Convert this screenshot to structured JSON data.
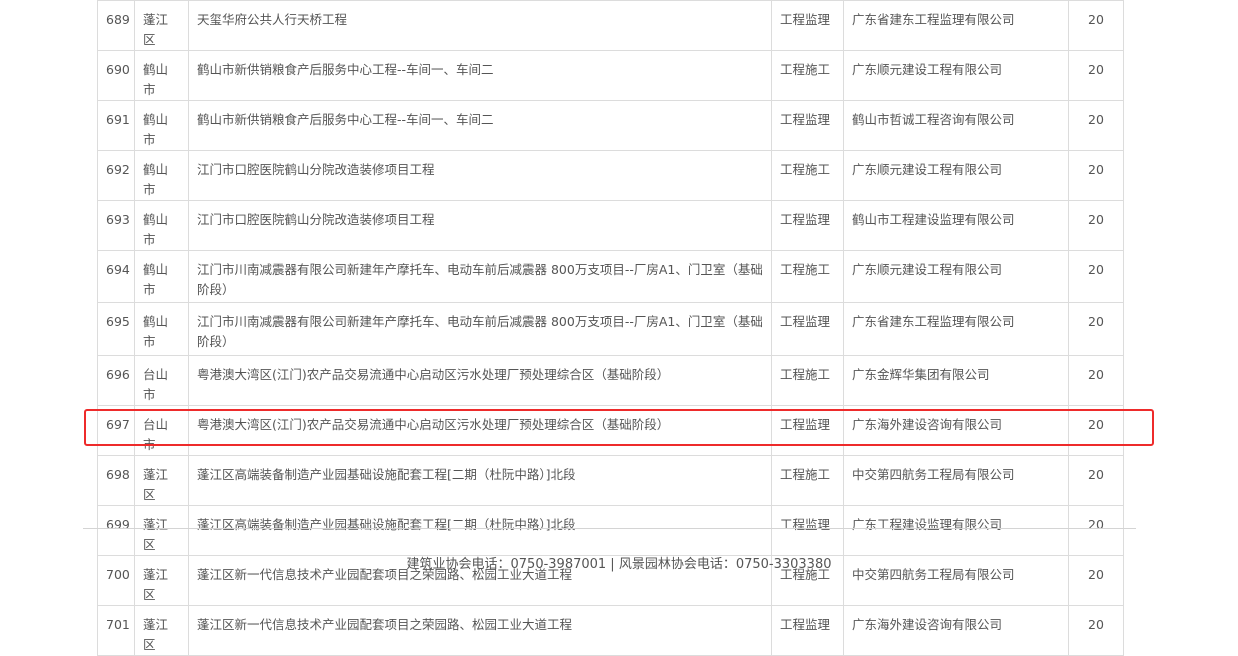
{
  "rows": [
    {
      "no": "689",
      "district": "蓬江区",
      "project": "天玺华府公共人行天桥工程",
      "type": "工程监理",
      "company": "广东省建东工程监理有限公司",
      "score": "20"
    },
    {
      "no": "690",
      "district": "鹤山市",
      "project": "鹤山市新供销粮食产后服务中心工程--车间一、车间二",
      "type": "工程施工",
      "company": "广东顺元建设工程有限公司",
      "score": "20"
    },
    {
      "no": "691",
      "district": "鹤山市",
      "project": "鹤山市新供销粮食产后服务中心工程--车间一、车间二",
      "type": "工程监理",
      "company": "鹤山市哲诚工程咨询有限公司",
      "score": "20"
    },
    {
      "no": "692",
      "district": "鹤山市",
      "project": "江门市口腔医院鹤山分院改造装修项目工程",
      "type": "工程施工",
      "company": "广东顺元建设工程有限公司",
      "score": "20"
    },
    {
      "no": "693",
      "district": "鹤山市",
      "project": "江门市口腔医院鹤山分院改造装修项目工程",
      "type": "工程监理",
      "company": "鹤山市工程建设监理有限公司",
      "score": "20"
    },
    {
      "no": "694",
      "district": "鹤山市",
      "project": "江门市川南减震器有限公司新建年产摩托车、电动车前后减震器 800万支项目--厂房A1、门卫室（基础阶段）",
      "type": "工程施工",
      "company": "广东顺元建设工程有限公司",
      "score": "20"
    },
    {
      "no": "695",
      "district": "鹤山市",
      "project": "江门市川南减震器有限公司新建年产摩托车、电动车前后减震器 800万支项目--厂房A1、门卫室（基础阶段）",
      "type": "工程监理",
      "company": "广东省建东工程监理有限公司",
      "score": "20"
    },
    {
      "no": "696",
      "district": "台山市",
      "project": "粤港澳大湾区(江门)农产品交易流通中心启动区污水处理厂预处理综合区（基础阶段）",
      "type": "工程施工",
      "company": "广东金辉华集团有限公司",
      "score": "20"
    },
    {
      "no": "697",
      "district": "台山市",
      "project": "粤港澳大湾区(江门)农产品交易流通中心启动区污水处理厂预处理综合区（基础阶段）",
      "type": "工程监理",
      "company": "广东海外建设咨询有限公司",
      "score": "20"
    },
    {
      "no": "698",
      "district": "蓬江区",
      "project": "蓬江区高端装备制造产业园基础设施配套工程[二期（杜阮中路）]北段",
      "type": "工程施工",
      "company": "中交第四航务工程局有限公司",
      "score": "20"
    },
    {
      "no": "699",
      "district": "蓬江区",
      "project": "蓬江区高端装备制造产业园基础设施配套工程[二期（杜阮中路）]北段",
      "type": "工程监理",
      "company": "广东工程建设监理有限公司",
      "score": "20"
    },
    {
      "no": "700",
      "district": "蓬江区",
      "project": "蓬江区新一代信息技术产业园配套项目之荣园路、松园工业大道工程",
      "type": "工程施工",
      "company": "中交第四航务工程局有限公司",
      "score": "20"
    },
    {
      "no": "701",
      "district": "蓬江区",
      "project": "蓬江区新一代信息技术产业园配套项目之荣园路、松园工业大道工程",
      "type": "工程监理",
      "company": "广东海外建设咨询有限公司",
      "score": "20"
    }
  ],
  "footer": {
    "contact": "建筑业协会电话：0750-3987001 | 风景园林协会电话：0750-3303380"
  },
  "colors": {
    "highlight_border": "#ee2b2b",
    "grid_border": "#dcdcdc",
    "text": "#555555"
  }
}
